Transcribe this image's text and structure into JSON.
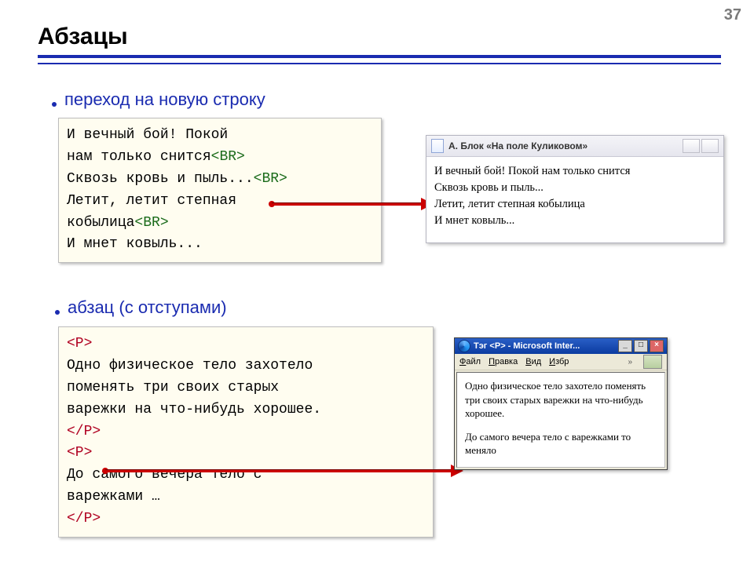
{
  "page_number": "37",
  "title": "Абзацы",
  "bullet1": "переход на новую строку",
  "bullet2": "абзац (с отступами)",
  "code1": {
    "l1": "И вечный бой! Покой",
    "l2a": "нам только снится",
    "br": "<BR>",
    "l3a": "Сквозь кровь и пыль...",
    "l4": "Летит, летит степная",
    "l5a": "кобылица",
    "l6": "И мнет ковыль..."
  },
  "mock1": {
    "title": "А. Блок  «На поле Куликовом»",
    "line1": "И вечный бой! Покой нам только снится",
    "line2": "Сквозь кровь и пыль...",
    "line3": "Летит, летит степная кобылица",
    "line4": "И мнет ковыль..."
  },
  "code2": {
    "p_open": "<P>",
    "p_close": "</P>",
    "t1": "Одно физическое тело захотело",
    "t2": "поменять три своих старых",
    "t3": "варежки на что-нибудь хорошее.",
    "t4": "До самого вечера тело с",
    "t5": "варежками …"
  },
  "mock2": {
    "title": "Тэг <P> - Microsoft Inter...",
    "menu": {
      "file": "Файл",
      "edit": "Правка",
      "view": "Вид",
      "fav": "Избр"
    },
    "para1": "Одно физическое тело захотело поменять три своих старых варежки на что-нибудь хорошее.",
    "para2": "До самого вечера тело с варежками то меняло"
  }
}
